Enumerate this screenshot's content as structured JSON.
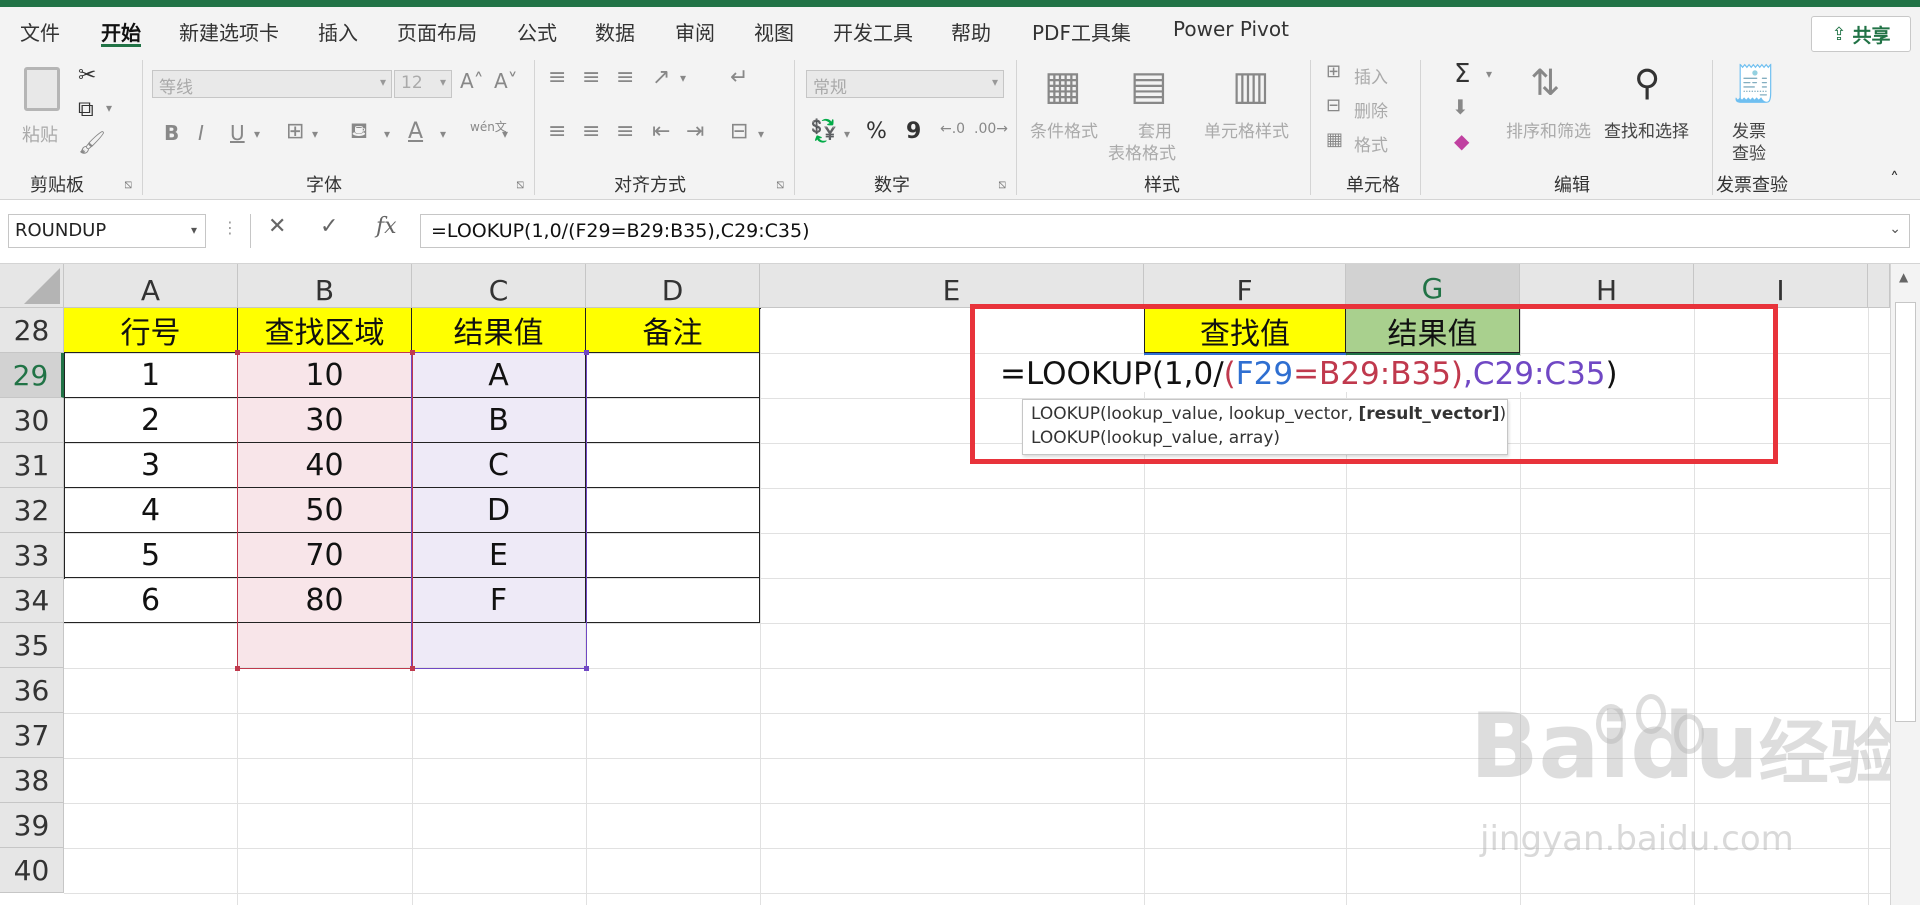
{
  "menu": {
    "items": [
      "文件",
      "开始",
      "新建选项卡",
      "插入",
      "页面布局",
      "公式",
      "数据",
      "审阅",
      "视图",
      "开发工具",
      "帮助",
      "PDF工具集",
      "Power Pivot"
    ],
    "active_index": 1,
    "share_label": "共享"
  },
  "ribbon": {
    "clipboard": {
      "paste": "粘贴",
      "label": "剪贴板"
    },
    "font": {
      "font_name": "等线",
      "font_size": "12",
      "bold": "B",
      "italic": "I",
      "underline": "U",
      "wen": "wén文",
      "label": "字体"
    },
    "alignment": {
      "label": "对齐方式"
    },
    "number": {
      "format": "常规",
      "percent": "%",
      "comma": "9",
      "label": "数字"
    },
    "styles": {
      "conditional": "条件格式",
      "table_format_1": "套用",
      "table_format_2": "表格格式",
      "cell_style": "单元格样式",
      "label": "样式"
    },
    "cells": {
      "insert": "插入",
      "delete": "删除",
      "format": "格式",
      "label": "单元格"
    },
    "editing": {
      "sum": "Σ",
      "sort": "排序和筛选",
      "find": "查找和选择",
      "label": "编辑"
    },
    "invoice": {
      "btn_1": "发票",
      "btn_2": "查验",
      "label": "发票查验"
    }
  },
  "formula_bar": {
    "name_box": "ROUNDUP",
    "cancel": "✕",
    "enter": "✓",
    "fx": "fx",
    "formula": "=LOOKUP(1,0/(F29=B29:B35),C29:C35)"
  },
  "columns": [
    "A",
    "B",
    "C",
    "D",
    "E",
    "F",
    "G",
    "H",
    "I"
  ],
  "rows": [
    "28",
    "29",
    "30",
    "31",
    "32",
    "33",
    "34",
    "35",
    "36",
    "37",
    "38",
    "39",
    "40"
  ],
  "selected_row": "29",
  "selected_col": "G",
  "table": {
    "headers": [
      "行号",
      "查找区域",
      "结果值",
      "备注"
    ],
    "rows": [
      [
        "1",
        "10",
        "A",
        ""
      ],
      [
        "2",
        "30",
        "B",
        ""
      ],
      [
        "3",
        "40",
        "C",
        ""
      ],
      [
        "4",
        "50",
        "D",
        ""
      ],
      [
        "5",
        "70",
        "E",
        ""
      ],
      [
        "6",
        "80",
        "F",
        ""
      ]
    ]
  },
  "lookup": {
    "find_header": "查找值",
    "result_header": "结果值"
  },
  "edit_formula": {
    "p1": "=LOOKUP(1,0/",
    "p2": "(",
    "p3": "F29",
    "p4": "=",
    "p5": "B29:B35",
    "p6": ")",
    "p7": ",",
    "p8": "C29:C35",
    "p9": ")"
  },
  "tooltip": {
    "line1_a": "LOOKUP(lookup_value, lookup_vector, ",
    "line1_b": "[result_vector]",
    "line1_c": ")",
    "line2": "LOOKUP(lookup_value, array)"
  },
  "watermark": {
    "main": "Bai",
    "du": "du",
    "cn": "经验",
    "sub": "jingyan.baidu.com"
  },
  "colors": {
    "excel_green": "#217346",
    "header_yellow": "#ffff00",
    "header_green": "#a9d08e",
    "red_box": "#e8333b",
    "ref_blue": "#2f6fd1",
    "ref_red": "#c0394d",
    "ref_purple": "#7048c4"
  }
}
